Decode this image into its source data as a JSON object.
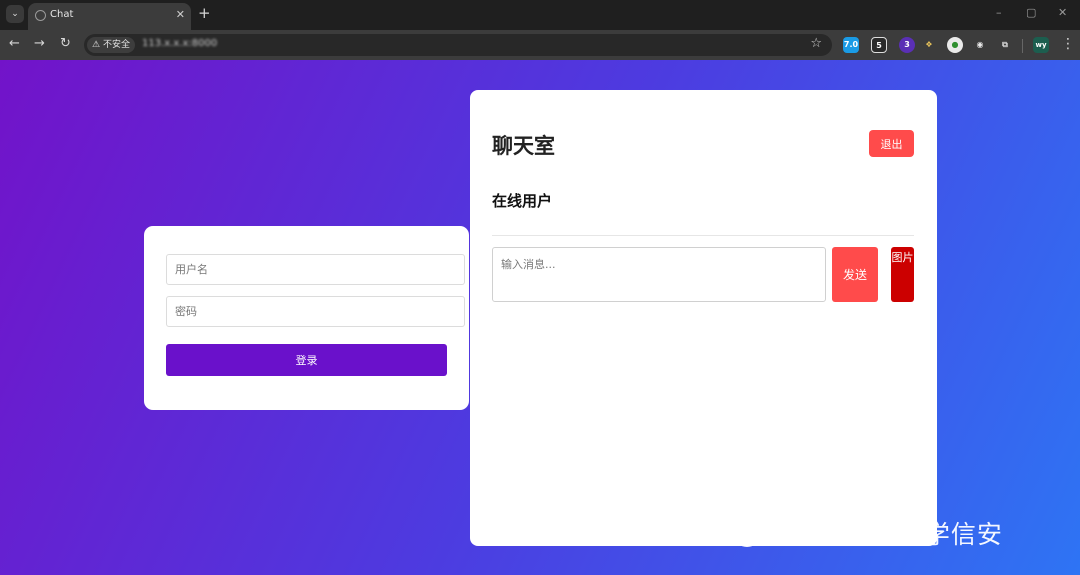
{
  "browser": {
    "tab_title": "Chat",
    "tab_close": "✕",
    "new_tab": "+",
    "security_label": "不安全",
    "url": "113.x.x.x:8000",
    "window_controls": [
      "–",
      "▢",
      "✕"
    ],
    "extension_badges": [
      "7.0",
      "5",
      "3",
      "",
      "",
      "",
      "",
      "wy"
    ]
  },
  "login": {
    "username_placeholder": "用户名",
    "password_placeholder": "密码",
    "login_label": "登录"
  },
  "chat": {
    "title": "聊天室",
    "logout_label": "退出",
    "online_users_title": "在线用户",
    "message_placeholder": "输入消息...",
    "send_label": "发送",
    "image_label": "图片"
  },
  "watermark": {
    "text": "公众号 · 菜鸟学信安"
  },
  "colors": {
    "gradient_start": "#7213c9",
    "gradient_end": "#2e74f4",
    "login_button": "#6a11cb",
    "logout_button": "#ff4b4b",
    "send_button": "#ff4b4b",
    "image_button": "#cc0000"
  }
}
